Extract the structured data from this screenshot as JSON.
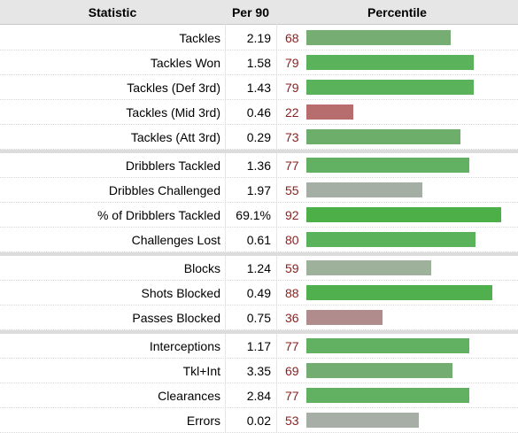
{
  "header": {
    "statistic": "Statistic",
    "per90": "Per 90",
    "percentile": "Percentile"
  },
  "colors": {
    "high": "#4caf50",
    "mid_high": "#66b068",
    "mid": "#6fae6f",
    "neutral": "#a7b0a8",
    "low": "#b66a6a",
    "low_mid": "#b08a8a"
  },
  "groups": [
    {
      "rows": [
        {
          "stat": "Tackles",
          "per90": "2.19",
          "pct": "68",
          "pct_value": 68,
          "color": "#75ad73"
        },
        {
          "stat": "Tackles Won",
          "per90": "1.58",
          "pct": "79",
          "pct_value": 79,
          "color": "#5ab25a"
        },
        {
          "stat": "Tackles (Def 3rd)",
          "per90": "1.43",
          "pct": "79",
          "pct_value": 79,
          "color": "#5ab25a"
        },
        {
          "stat": "Tackles (Mid 3rd)",
          "per90": "0.46",
          "pct": "22",
          "pct_value": 22,
          "color": "#b76d6d"
        },
        {
          "stat": "Tackles (Att 3rd)",
          "per90": "0.29",
          "pct": "73",
          "pct_value": 73,
          "color": "#6cae6a"
        }
      ]
    },
    {
      "rows": [
        {
          "stat": "Dribblers Tackled",
          "per90": "1.36",
          "pct": "77",
          "pct_value": 77,
          "color": "#62b061"
        },
        {
          "stat": "Dribbles Challenged",
          "per90": "1.97",
          "pct": "55",
          "pct_value": 55,
          "color": "#a4aea4"
        },
        {
          "stat": "% of Dribblers Tackled",
          "per90": "69.1%",
          "pct": "92",
          "pct_value": 92,
          "color": "#4caf47"
        },
        {
          "stat": "Challenges Lost",
          "per90": "0.61",
          "pct": "80",
          "pct_value": 80,
          "color": "#5ab25a"
        }
      ]
    },
    {
      "rows": [
        {
          "stat": "Blocks",
          "per90": "1.24",
          "pct": "59",
          "pct_value": 59,
          "color": "#9db19b"
        },
        {
          "stat": "Shots Blocked",
          "per90": "0.49",
          "pct": "88",
          "pct_value": 88,
          "color": "#4fb04d"
        },
        {
          "stat": "Passes Blocked",
          "per90": "0.75",
          "pct": "36",
          "pct_value": 36,
          "color": "#b08c8c"
        }
      ]
    },
    {
      "rows": [
        {
          "stat": "Interceptions",
          "per90": "1.17",
          "pct": "77",
          "pct_value": 77,
          "color": "#62b061"
        },
        {
          "stat": "Tkl+Int",
          "per90": "3.35",
          "pct": "69",
          "pct_value": 69,
          "color": "#73ad71"
        },
        {
          "stat": "Clearances",
          "per90": "2.84",
          "pct": "77",
          "pct_value": 77,
          "color": "#62b061"
        },
        {
          "stat": "Errors",
          "per90": "0.02",
          "pct": "53",
          "pct_value": 53,
          "color": "#a6aea6"
        }
      ]
    }
  ]
}
